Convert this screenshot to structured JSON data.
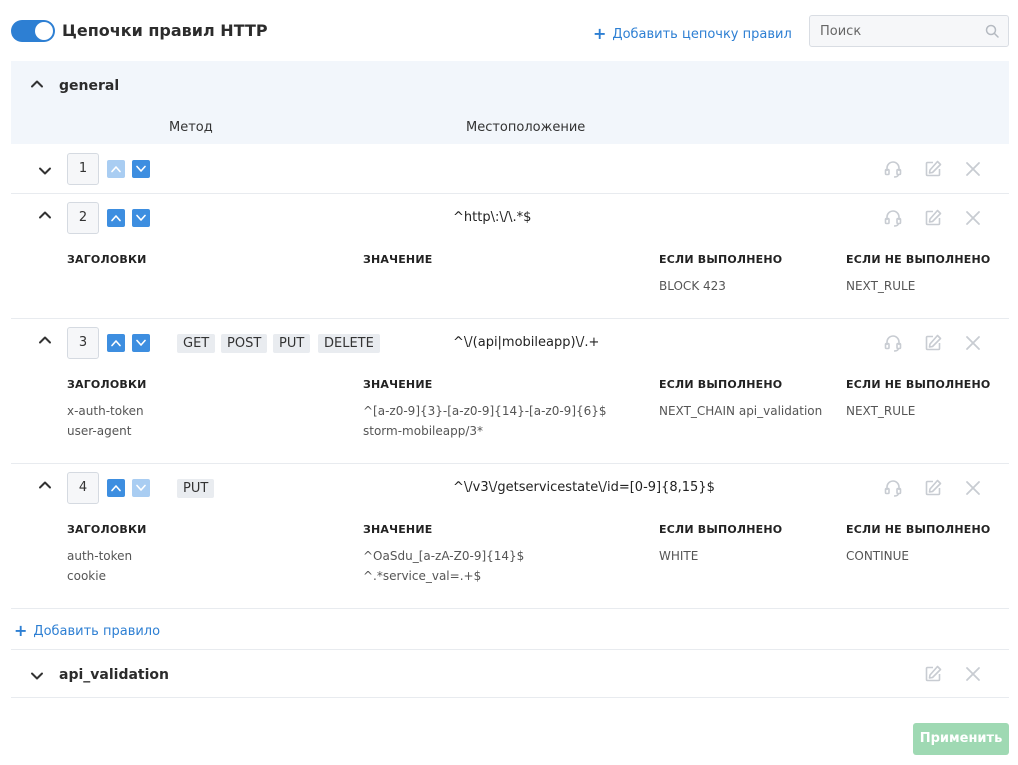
{
  "header": {
    "toggle_on": true,
    "title": "Цепочки правил HTTP",
    "add_chain_label": "Добавить цепочку правил",
    "search_placeholder": "Поиск"
  },
  "chains": [
    {
      "name": "general",
      "expanded": true,
      "columns": {
        "method": "Метод",
        "location": "Местоположение"
      },
      "sub_headers": {
        "headers": "ЗАГОЛОВКИ",
        "value": "ЗНАЧЕНИЕ",
        "if_matched": "ЕСЛИ ВЫПОЛНЕНО",
        "if_not_matched": "ЕСЛИ НЕ ВЫПОЛНЕНО"
      },
      "rules": [
        {
          "num": "1",
          "expanded": false,
          "methods": [],
          "location": "",
          "headers": [],
          "values": [],
          "if_matched": "",
          "if_not_matched": ""
        },
        {
          "num": "2",
          "expanded": true,
          "methods": [],
          "location": "^http\\:\\/\\.*$",
          "headers": [],
          "values": [],
          "if_matched": "BLOCK 423",
          "if_not_matched": "NEXT_RULE"
        },
        {
          "num": "3",
          "expanded": true,
          "methods": [
            "GET",
            "POST",
            "PUT",
            "DELETE"
          ],
          "location": "^\\/(api|mobileapp)\\/.+",
          "headers": [
            "x-auth-token",
            "user-agent"
          ],
          "values": [
            "^[a-z0-9]{3}-[a-z0-9]{14}-[a-z0-9]{6}$",
            "storm-mobileapp/3*"
          ],
          "if_matched": "NEXT_CHAIN api_validation",
          "if_not_matched": "NEXT_RULE"
        },
        {
          "num": "4",
          "expanded": true,
          "methods": [
            "PUT"
          ],
          "location": "^\\/v3\\/getservicestate\\/id=[0-9]{8,15}$",
          "headers": [
            "auth-token",
            "cookie"
          ],
          "values": [
            "^OaSdu_[a-zA-Z0-9]{14}$",
            "^.*service_val=.+$"
          ],
          "if_matched": "WHITE",
          "if_not_matched": "CONTINUE"
        }
      ],
      "add_rule_label": "Добавить правило"
    },
    {
      "name": "api_validation",
      "expanded": false
    }
  ],
  "footer": {
    "apply_label": "Применить"
  },
  "icons": {
    "collapse": "chevron-up-icon",
    "expand": "chevron-down-icon",
    "move_up": "arrow-up-icon",
    "move_down": "arrow-down-icon",
    "test": "headset-icon",
    "edit": "edit-icon",
    "delete": "close-icon",
    "search": "search-icon"
  },
  "colors": {
    "accent": "#2d7fd3",
    "panel_bg": "#f2f6fb",
    "apply_disabled": "#9fd9b3",
    "icon_gray": "#c8ccd2"
  }
}
